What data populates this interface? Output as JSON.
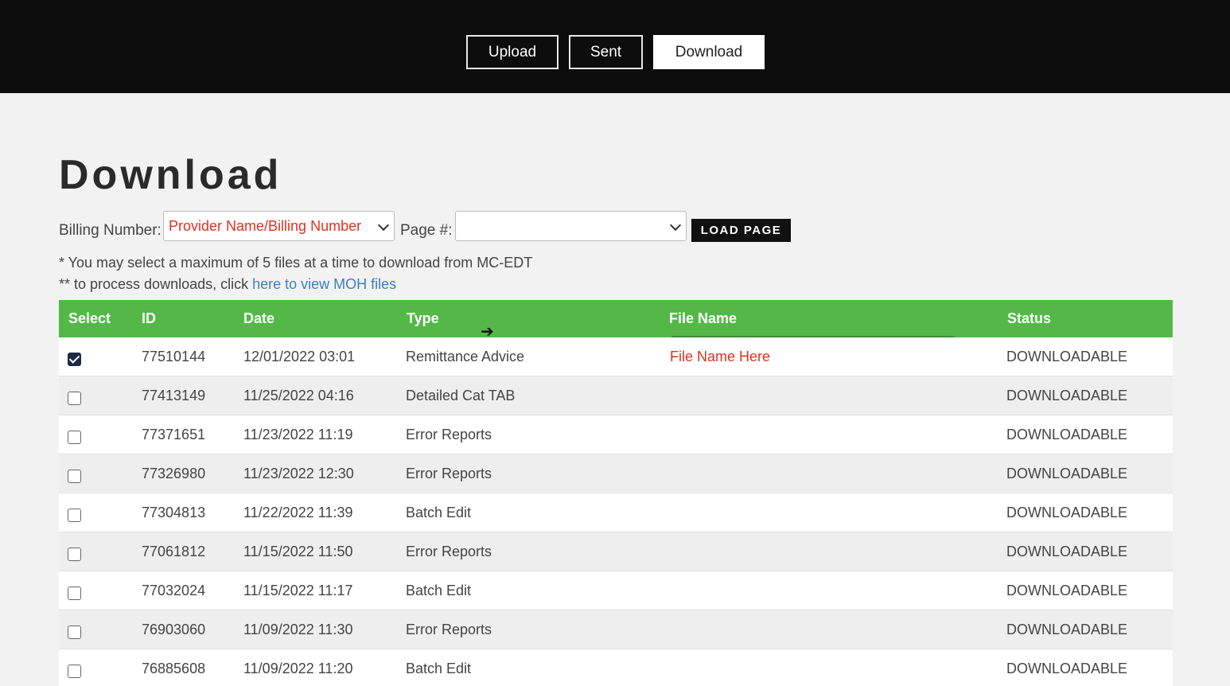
{
  "nav": {
    "upload_label": "Upload",
    "sent_label": "Sent",
    "download_label": "Download"
  },
  "page_title": "Download",
  "controls": {
    "billing_label": "Billing Number:",
    "billing_value": "Provider Name/Billing Number",
    "page_label": "Page #:",
    "page_value": "",
    "load_button": "LOAD PAGE"
  },
  "notes": {
    "max_files": "* You may select a maximum of 5 files at a time to download from MC-EDT",
    "process_prefix": "** to process downloads, click ",
    "process_link": "here to view MOH files"
  },
  "table": {
    "headers": {
      "select": "Select",
      "id": "ID",
      "date": "Date",
      "type": "Type",
      "file_name": "File Name",
      "status": "Status"
    },
    "rows": [
      {
        "checked": true,
        "id": "77510144",
        "date": "12/01/2022 03:01",
        "type": "Remittance Advice",
        "file_name": "File Name Here",
        "status": "DOWNLOADABLE"
      },
      {
        "checked": false,
        "id": "77413149",
        "date": "11/25/2022 04:16",
        "type": "Detailed Cat TAB",
        "file_name": "",
        "status": "DOWNLOADABLE"
      },
      {
        "checked": false,
        "id": "77371651",
        "date": "11/23/2022 11:19",
        "type": "Error Reports",
        "file_name": "",
        "status": "DOWNLOADABLE"
      },
      {
        "checked": false,
        "id": "77326980",
        "date": "11/23/2022 12:30",
        "type": "Error Reports",
        "file_name": "",
        "status": "DOWNLOADABLE"
      },
      {
        "checked": false,
        "id": "77304813",
        "date": "11/22/2022 11:39",
        "type": "Batch Edit",
        "file_name": "",
        "status": "DOWNLOADABLE"
      },
      {
        "checked": false,
        "id": "77061812",
        "date": "11/15/2022 11:50",
        "type": "Error Reports",
        "file_name": "",
        "status": "DOWNLOADABLE"
      },
      {
        "checked": false,
        "id": "77032024",
        "date": "11/15/2022 11:17",
        "type": "Batch Edit",
        "file_name": "",
        "status": "DOWNLOADABLE"
      },
      {
        "checked": false,
        "id": "76903060",
        "date": "11/09/2022 11:30",
        "type": "Error Reports",
        "file_name": "",
        "status": "DOWNLOADABLE"
      },
      {
        "checked": false,
        "id": "76885608",
        "date": "11/09/2022 11:20",
        "type": "Batch Edit",
        "file_name": "",
        "status": "DOWNLOADABLE"
      }
    ]
  },
  "icons": {
    "select_chevron": "chevron-down-icon",
    "cursor": "arrow-cursor-icon"
  }
}
